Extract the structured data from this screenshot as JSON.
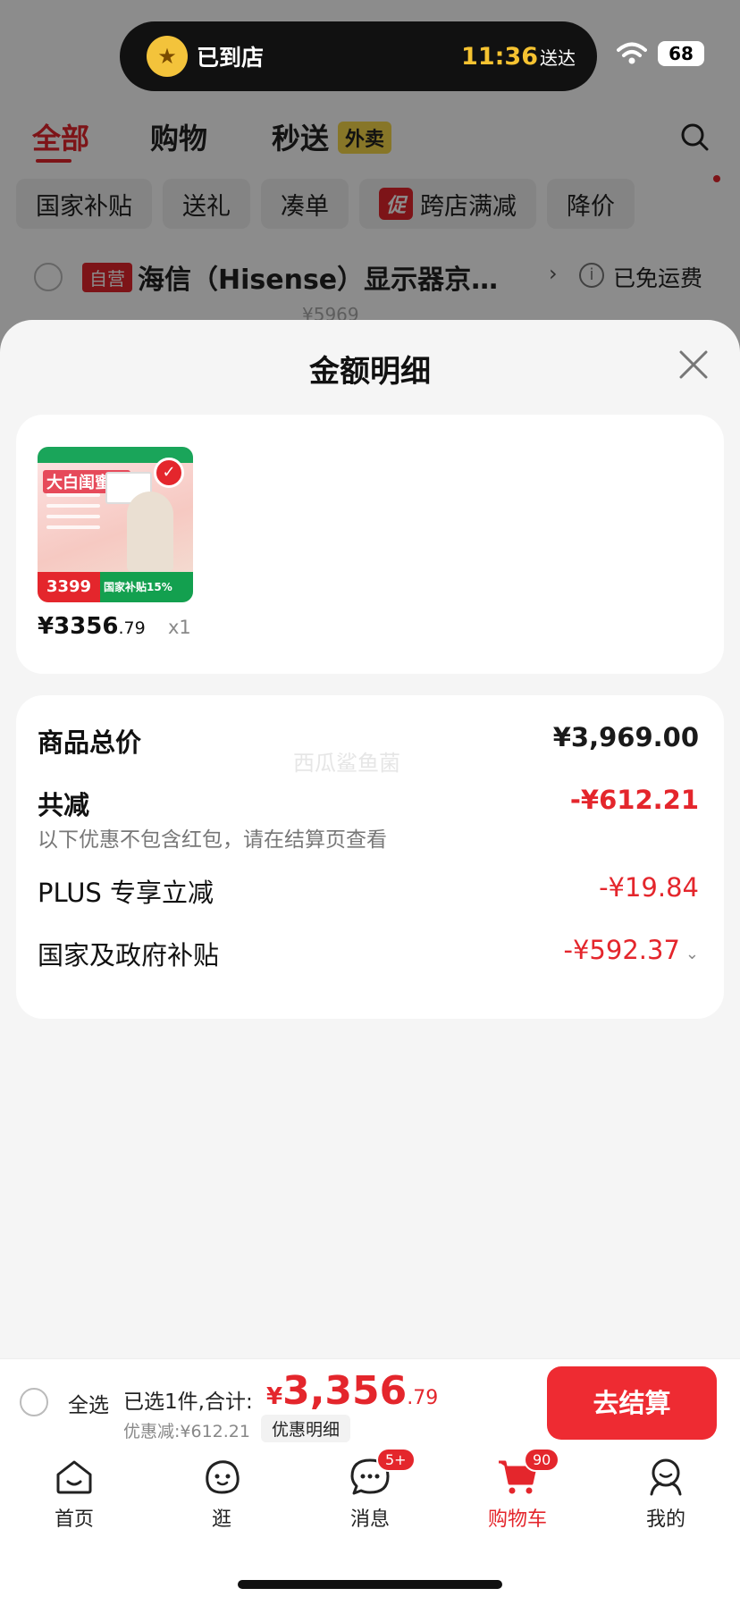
{
  "status_bar": {
    "store_status": "已到店",
    "eta_time": "11:36",
    "eta_suffix": "送达",
    "battery": "68"
  },
  "tabs": [
    {
      "label": "全部",
      "active": true
    },
    {
      "label": "购物"
    },
    {
      "label": "秒送"
    }
  ],
  "takeout_badge": "外卖",
  "filter_chips": {
    "national_subsidy": "国家补贴",
    "gift": "送礼",
    "bundle": "凑单",
    "promo_tag": "促",
    "cross_store": "跨店满减",
    "price_drop": "降价"
  },
  "cart_store": {
    "self_tag": "自营",
    "name": "海信（Hisense）显示器京…",
    "free_shipping": "已免运费",
    "old_price": "¥5969"
  },
  "sheet": {
    "title": "金额明细",
    "watermark": "西瓜鲨鱼菌",
    "product": {
      "thumb_headline": "大白闺蜜机",
      "thumb_price": "3399",
      "thumb_subsidy": "国家补贴15%",
      "price_currency": "¥",
      "price_int": "3356",
      "price_dec": ".79",
      "qty": "x1"
    },
    "breakdown": {
      "total_label": "商品总价",
      "total_value": "¥3,969.00",
      "reduced_label": "共减",
      "reduced_value": "-¥612.21",
      "note": "以下优惠不包含红包，请在结算页查看",
      "plus_label": "PLUS 专享立减",
      "plus_value": "-¥19.84",
      "subsidy_label": "国家及政府补贴",
      "subsidy_value": "-¥592.37"
    }
  },
  "checkout": {
    "select_all": "全选",
    "selected_count": "已选1件,合计:",
    "total_currency": "¥",
    "total_int": "3,356",
    "total_dec": ".79",
    "discount": "优惠减:¥612.21",
    "detail_link": "优惠明细",
    "button": "去结算"
  },
  "bottom_nav": [
    {
      "label": "首页"
    },
    {
      "label": "逛"
    },
    {
      "label": "消息",
      "badge": "5+"
    },
    {
      "label": "购物车",
      "badge": "90",
      "active": true
    },
    {
      "label": "我的"
    }
  ],
  "colors": {
    "accent": "#e4262c",
    "checkout_button": "#ee2b32",
    "eta": "#f6c331"
  }
}
